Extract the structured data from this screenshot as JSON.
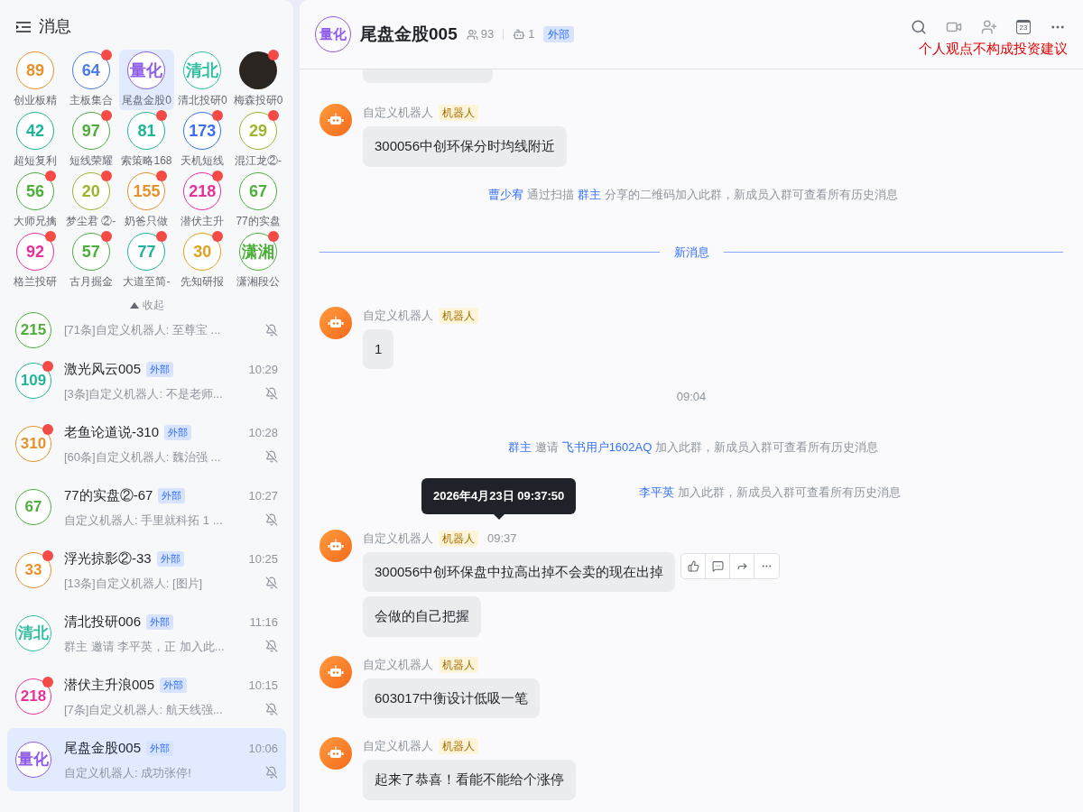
{
  "sidebar": {
    "title": "消息",
    "pinned": [
      {
        "label": "89",
        "kind": "text",
        "color": "#e8902a",
        "name": "创业板精",
        "unread": false,
        "selected": false
      },
      {
        "label": "64",
        "kind": "text",
        "color": "#4a7cf0",
        "name": "主板集合",
        "unread": true,
        "selected": false
      },
      {
        "label": "量化",
        "kind": "text",
        "color": "#8e5ce8",
        "name": "尾盘金股0",
        "unread": false,
        "selected": true
      },
      {
        "label": "清北",
        "kind": "text",
        "color": "#2fbfa0",
        "name": "清北投研0",
        "unread": false,
        "selected": false
      },
      {
        "kind": "image",
        "name": "梅森投研0",
        "unread": true,
        "selected": false
      },
      {
        "label": "42",
        "kind": "text",
        "color": "#1fb49a",
        "name": "超短复利",
        "unread": false,
        "selected": false
      },
      {
        "label": "97",
        "kind": "text",
        "color": "#4caf3a",
        "name": "短线荣耀",
        "unread": true,
        "selected": false
      },
      {
        "label": "81",
        "kind": "text",
        "color": "#1fb49a",
        "name": "索策略168",
        "unread": true,
        "selected": false
      },
      {
        "label": "173",
        "kind": "text",
        "color": "#3b6ef0",
        "name": "天机短线",
        "unread": true,
        "selected": false
      },
      {
        "label": "29",
        "kind": "text",
        "color": "#9cb52a",
        "name": "混江龙②-",
        "unread": true,
        "selected": false
      },
      {
        "label": "56",
        "kind": "text",
        "color": "#4caf3a",
        "name": "大师兄擒",
        "unread": true,
        "selected": false
      },
      {
        "label": "20",
        "kind": "text",
        "color": "#9cb52a",
        "name": "梦尘君 ②-",
        "unread": true,
        "selected": false
      },
      {
        "label": "155",
        "kind": "text",
        "color": "#e8902a",
        "name": "奶爸只做",
        "unread": true,
        "selected": false
      },
      {
        "label": "218",
        "kind": "text",
        "color": "#e8309a",
        "name": "潜伏主升",
        "unread": true,
        "selected": false
      },
      {
        "label": "67",
        "kind": "text",
        "color": "#4caf3a",
        "name": "77的实盘",
        "unread": false,
        "selected": false
      },
      {
        "label": "92",
        "kind": "text",
        "color": "#e8309a",
        "name": "格兰投研",
        "unread": true,
        "selected": false
      },
      {
        "label": "57",
        "kind": "text",
        "color": "#4caf3a",
        "name": "古月掘金",
        "unread": true,
        "selected": false
      },
      {
        "label": "77",
        "kind": "text",
        "color": "#1fb49a",
        "name": "大道至简-",
        "unread": true,
        "selected": false
      },
      {
        "label": "30",
        "kind": "text",
        "color": "#e0a020",
        "name": "先知研报",
        "unread": true,
        "selected": false
      },
      {
        "label": "潇湘",
        "kind": "text",
        "color": "#4caf3a",
        "name": "潇湘段公",
        "unread": true,
        "selected": false
      }
    ],
    "collapse": "收起",
    "chats": [
      {
        "avatar": "215",
        "color": "#4caf3a",
        "unread": false,
        "selected": false,
        "preview": "[71条]自定义机器人: 至尊宝 ..."
      },
      {
        "avatar": "109",
        "color": "#1fb49a",
        "unread": true,
        "selected": false,
        "title": "激光风云005",
        "tag": "外部",
        "time": "10:29",
        "preview": "[3条]自定义机器人: 不是老师..."
      },
      {
        "avatar": "310",
        "color": "#e8902a",
        "unread": true,
        "selected": false,
        "title": "老鱼论道说-310",
        "tag": "外部",
        "time": "10:28",
        "preview": "[60条]自定义机器人: 魏治强 ..."
      },
      {
        "avatar": "67",
        "color": "#4caf3a",
        "unread": false,
        "selected": false,
        "title": "77的实盘②-67",
        "tag": "外部",
        "time": "10:27",
        "preview": "自定义机器人: 手里就科拓 1 ..."
      },
      {
        "avatar": "33",
        "color": "#e8902a",
        "unread": true,
        "selected": false,
        "title": "浮光掠影②-33",
        "tag": "外部",
        "time": "10:25",
        "preview": "[13条]自定义机器人: [图片]"
      },
      {
        "avatar": "清北",
        "color": "#2fbfa0",
        "unread": false,
        "selected": false,
        "title": "清北投研006",
        "tag": "外部",
        "time": "11:16",
        "preview": "群主 邀请 李平英，正 加入此..."
      },
      {
        "avatar": "218",
        "color": "#e8309a",
        "unread": true,
        "selected": false,
        "title": "潜伏主升浪005",
        "tag": "外部",
        "time": "10:15",
        "preview": "[7条]自定义机器人: 航天线强..."
      },
      {
        "avatar": "量化",
        "color": "#8e5ce8",
        "unread": false,
        "selected": true,
        "title": "尾盘金股005",
        "tag": "外部",
        "time": "10:06",
        "preview": "自定义机器人: 成功张停!"
      }
    ]
  },
  "chat": {
    "avatar": "量化",
    "title": "尾盘金股005",
    "members": "93",
    "bots": "1",
    "tag": "外部",
    "calendar_day": "23",
    "disclaimer": "个人观点不构成投资建议",
    "items": [
      {
        "kind": "stub"
      },
      {
        "kind": "message",
        "sender": "自定义机器人",
        "badge": "机器人",
        "bubbles": [
          "300056中创环保分时均线附近"
        ]
      },
      {
        "kind": "system",
        "parts": [
          {
            "text": "曹少宥",
            "link": true
          },
          {
            "text": "通过扫描",
            "link": false
          },
          {
            "text": "群主",
            "link": true
          },
          {
            "text": "分享的二维码加入此群，新成员入群可查看所有历史消息",
            "link": false
          }
        ]
      },
      {
        "kind": "divider",
        "text": "新消息"
      },
      {
        "kind": "message",
        "sender": "自定义机器人",
        "badge": "机器人",
        "bubbles": [
          "1"
        ]
      },
      {
        "kind": "time",
        "text": "09:04"
      },
      {
        "kind": "system",
        "parts": [
          {
            "text": "群主",
            "link": true
          },
          {
            "text": "邀请",
            "link": false
          },
          {
            "text": "飞书用户1602AQ",
            "link": true
          },
          {
            "text": "加入此群，新成员入群可查看所有历史消息",
            "link": false
          }
        ]
      },
      {
        "kind": "system",
        "tooltip": "2026年4月23日 09:37:50",
        "parts": [
          {
            "text": "李平英",
            "link": true
          },
          {
            "text": "加入此群，新成员入群可查看所有历史消息",
            "link": false
          }
        ]
      },
      {
        "kind": "message",
        "sender": "自定义机器人",
        "badge": "机器人",
        "time": "09:37",
        "actions": true,
        "bubbles": [
          "300056中创环保盘中拉高出掉不会卖的现在出掉",
          "会做的自己把握"
        ]
      },
      {
        "kind": "message",
        "sender": "自定义机器人",
        "badge": "机器人",
        "bubbles": [
          "603017中衡设计低吸一笔"
        ]
      },
      {
        "kind": "message",
        "sender": "自定义机器人",
        "badge": "机器人",
        "bubbles": [
          "起来了恭喜！看能不能给个涨停"
        ]
      }
    ]
  }
}
